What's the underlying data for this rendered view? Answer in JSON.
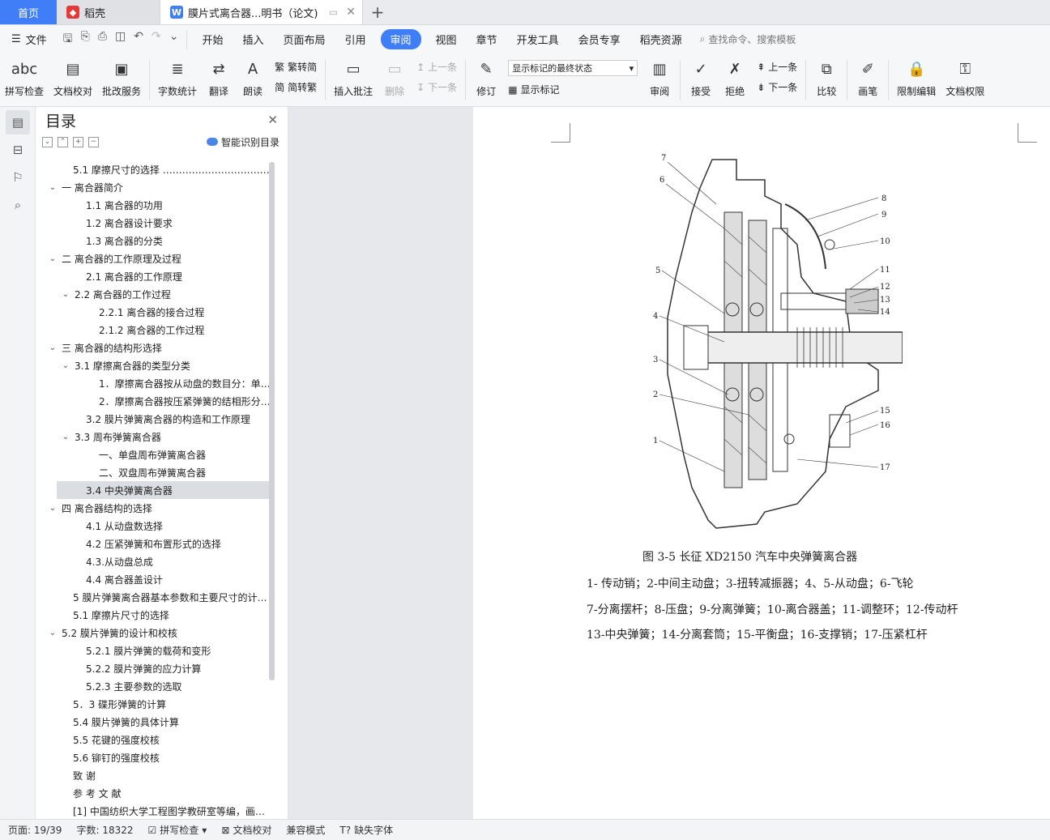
{
  "tabs": {
    "home": "首页",
    "wps": "稻壳",
    "doc": "膜片式离合器...明书（论文)"
  },
  "menu": {
    "file": "文件",
    "items": [
      "开始",
      "插入",
      "页面布局",
      "引用",
      "审阅",
      "视图",
      "章节",
      "开发工具",
      "会员专享",
      "稻壳资源"
    ],
    "active": "审阅",
    "search": "查找命令、搜索模板"
  },
  "ribbon": {
    "spell": "拼写检查",
    "proof": "文档校对",
    "annot_service": "批改服务",
    "wordcount": "字数统计",
    "translate": "翻译",
    "read": "朗读",
    "t2s": "繁转简",
    "s2t": "简转繁",
    "insert_comment": "插入批注",
    "delete": "删除",
    "prev_comment": "上一条",
    "next_comment": "下一条",
    "revise": "修订",
    "show_state": "显示标记的最终状态",
    "show_marks": "显示标记",
    "review": "审阅",
    "accept": "接受",
    "reject": "拒绝",
    "prev": "上一条",
    "next": "下一条",
    "compare": "比较",
    "pen": "画笔",
    "restrict": "限制编辑",
    "rights": "文档权限"
  },
  "toc": {
    "title": "目录",
    "smart": "智能识别目录",
    "items": [
      {
        "label": "5.1 摩擦尺寸的选择 ……………………………",
        "level": 1,
        "arrow": ""
      },
      {
        "label": "一   离合器简介",
        "level": 0,
        "arrow": "⌄"
      },
      {
        "label": "1.1 离合器的功用",
        "level": 2,
        "arrow": ""
      },
      {
        "label": "1.2 离合器设计要求",
        "level": 2,
        "arrow": ""
      },
      {
        "label": "1.3 离合器的分类",
        "level": 2,
        "arrow": ""
      },
      {
        "label": "二  离合器的工作原理及过程",
        "level": 0,
        "arrow": "⌄"
      },
      {
        "label": "2.1  离合器的工作原理",
        "level": 2,
        "arrow": ""
      },
      {
        "label": "2.2 离合器的工作过程",
        "level": 1,
        "arrow": "⌄"
      },
      {
        "label": "2.2.1 离合器的接合过程",
        "level": 3,
        "arrow": ""
      },
      {
        "label": "2.1.2 离合器的工作过程",
        "level": 3,
        "arrow": ""
      },
      {
        "label": "三  离合器的结构形选择",
        "level": 0,
        "arrow": "⌄"
      },
      {
        "label": "3.1 摩擦离合器的类型分类",
        "level": 1,
        "arrow": "⌄"
      },
      {
        "label": "1．摩擦离合器按从动盘的数目分：单…",
        "level": 3,
        "arrow": ""
      },
      {
        "label": "2．摩擦离合器按压紧弹簧的结相形分:…",
        "level": 3,
        "arrow": ""
      },
      {
        "label": "3.2 膜片弹簧离合器的构造和工作原理",
        "level": 2,
        "arrow": ""
      },
      {
        "label": "3.3 周布弹簧离合器",
        "level": 1,
        "arrow": "⌄"
      },
      {
        "label": "一、单盘周布弹簧离合器",
        "level": 3,
        "arrow": ""
      },
      {
        "label": "二、双盘周布弹簧离合器",
        "level": 3,
        "arrow": ""
      },
      {
        "label": "3.4 中央弹簧离合器",
        "level": 2,
        "arrow": "",
        "selected": true
      },
      {
        "label": "四  离合器结构的选择",
        "level": 0,
        "arrow": "⌄"
      },
      {
        "label": "4.1 从动盘数选择",
        "level": 2,
        "arrow": ""
      },
      {
        "label": "4.2 压紧弹簧和布置形式的选择",
        "level": 2,
        "arrow": ""
      },
      {
        "label": "4.3.从动盘总成",
        "level": 2,
        "arrow": ""
      },
      {
        "label": "4.4 离合器盖设计",
        "level": 2,
        "arrow": ""
      },
      {
        "label": "5 膜片弹簧离合器基本参数和主要尺寸的计…",
        "level": 1,
        "arrow": ""
      },
      {
        "label": "5.1 摩擦片尺寸的选择",
        "level": 1,
        "arrow": ""
      },
      {
        "label": "5.2 膜片弹簧的设计和校核",
        "level": 0,
        "arrow": "⌄"
      },
      {
        "label": "5.2.1 膜片弹簧的载荷和变形",
        "level": 2,
        "arrow": ""
      },
      {
        "label": "5.2.2 膜片弹簧的应力计算",
        "level": 2,
        "arrow": ""
      },
      {
        "label": "5.2.3    主要参数的选取",
        "level": 2,
        "arrow": ""
      },
      {
        "label": "5．3 碟形弹簧的计算",
        "level": 1,
        "arrow": ""
      },
      {
        "label": "5.4 膜片弹簧的具体计算",
        "level": 1,
        "arrow": ""
      },
      {
        "label": "5.5 花键的强度校核",
        "level": 1,
        "arrow": ""
      },
      {
        "label": "5.6 铆钉的强度校核",
        "level": 1,
        "arrow": ""
      },
      {
        "label": "致    谢",
        "level": 1,
        "arrow": ""
      },
      {
        "label": "参  考  文  献",
        "level": 1,
        "arrow": ""
      },
      {
        "label": "[1]    中国纺织大学工程图学教研室等编，画…",
        "level": 1,
        "arrow": ""
      }
    ]
  },
  "document": {
    "figure_labels": [
      "7",
      "6",
      "8",
      "9",
      "10",
      "11",
      "5",
      "12",
      "13",
      "14",
      "4",
      "3",
      "2",
      "15",
      "16",
      "1",
      "17"
    ],
    "caption": "图 3-5  长征 XD2150 汽车中央弹簧离合器",
    "legend": [
      "1-   传动销；2-中间主动盘；3-扭转减振器；4、5-从动盘；6-飞轮",
      "7-分离摆杆；8-压盘；9-分离弹簧；10-离合器盖；11-调整环；12-传动杆",
      "13-中央弹簧；14-分离套筒；15-平衡盘；16-支撑销；17-压紧杠杆"
    ]
  },
  "status": {
    "page": "页面: 19/39",
    "words": "字数: 18322",
    "spell": "拼写检查",
    "proof": "文档校对",
    "compat": "兼容模式",
    "missing_font": "缺失字体"
  }
}
